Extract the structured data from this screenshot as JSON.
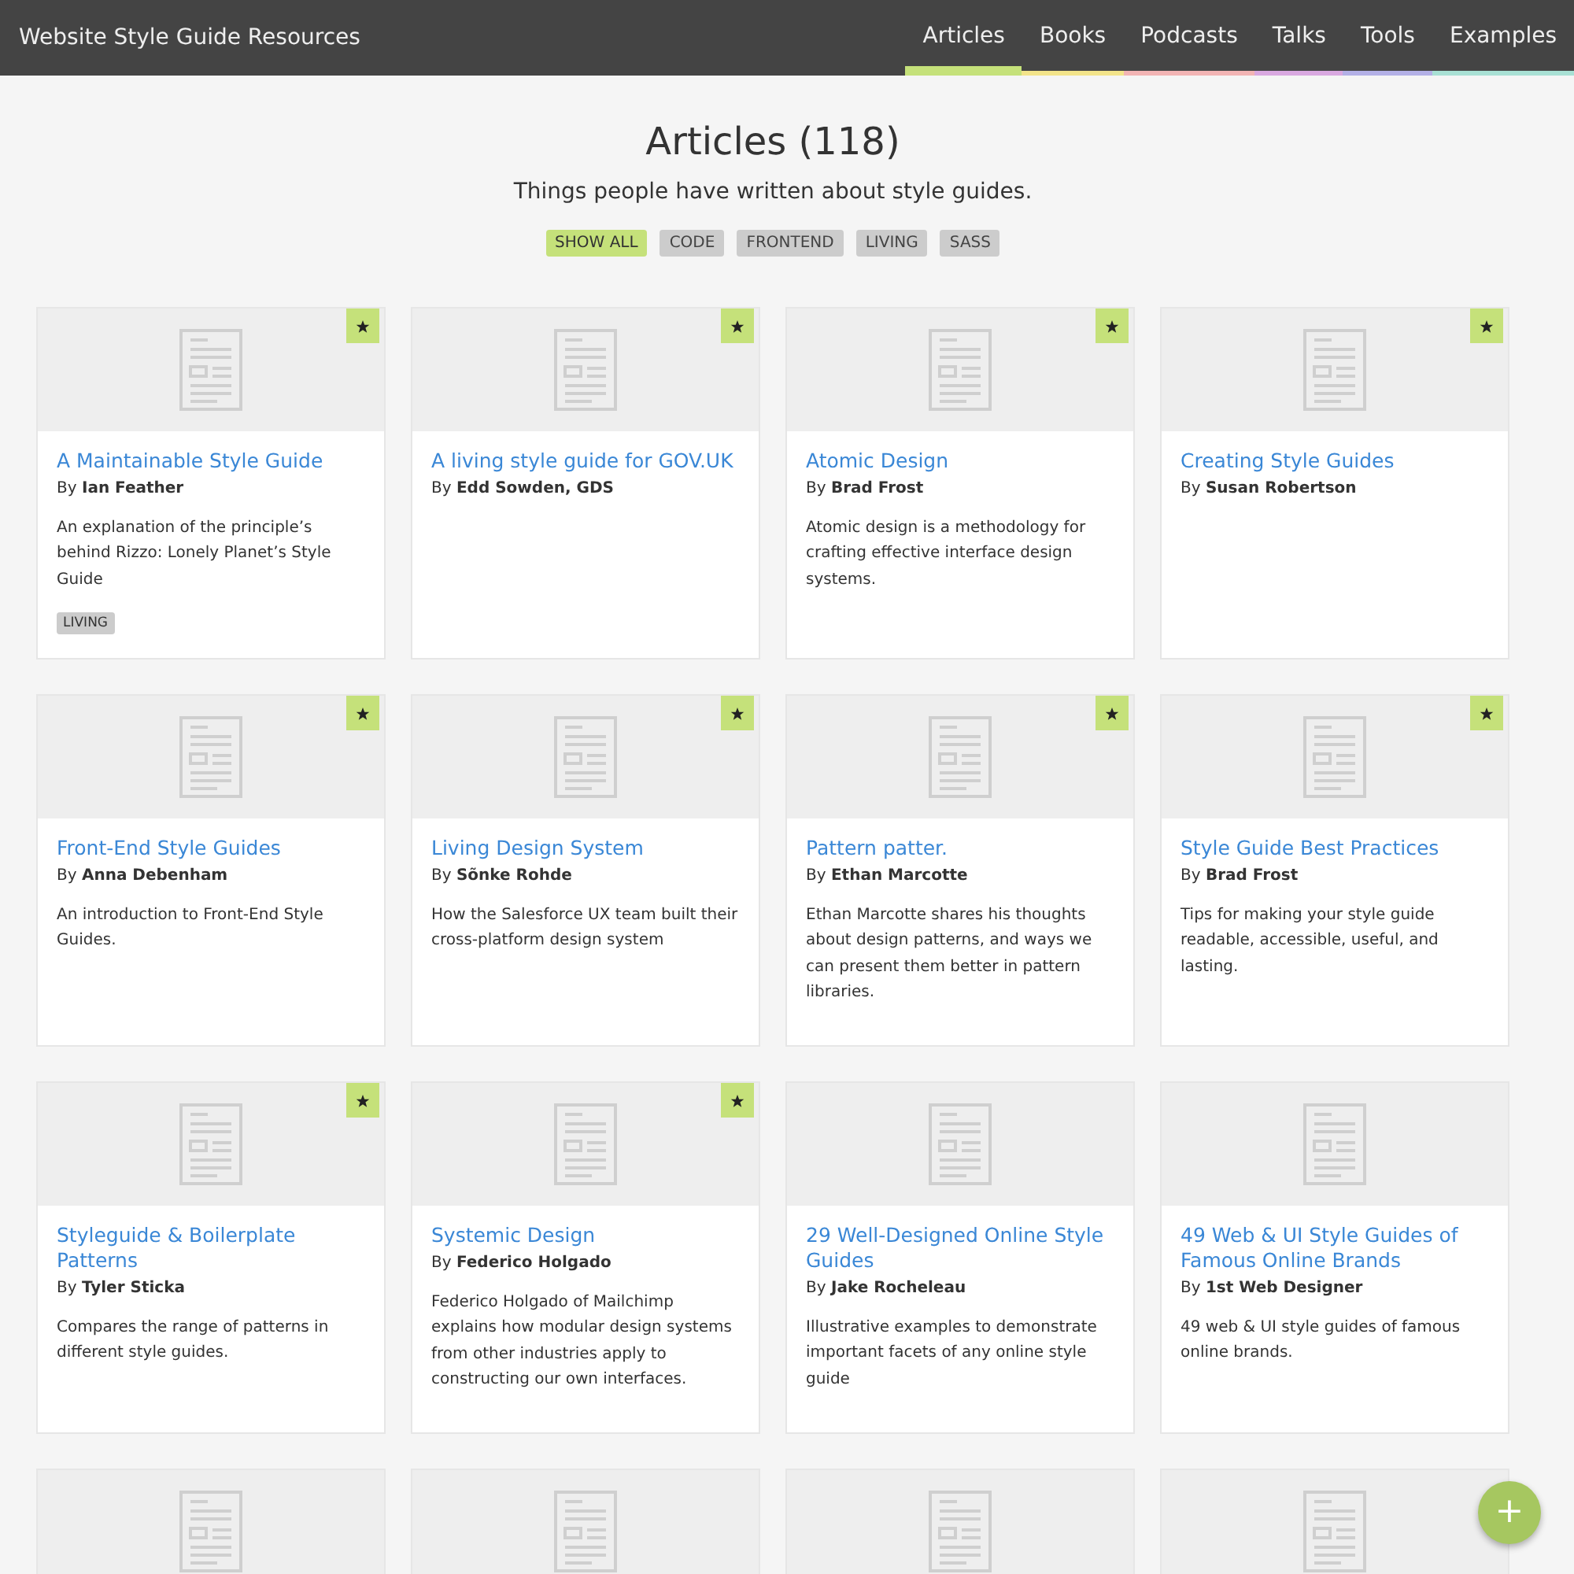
{
  "site_title": "Website Style Guide Resources",
  "nav": [
    {
      "label": "Articles",
      "selected": true,
      "color": "#c5e17a"
    },
    {
      "label": "Books",
      "selected": false,
      "color": "#f3e48a"
    },
    {
      "label": "Podcasts",
      "selected": false,
      "color": "#f2b4b4"
    },
    {
      "label": "Talks",
      "selected": false,
      "color": "#d9a8e0"
    },
    {
      "label": "Tools",
      "selected": false,
      "color": "#b3b0e6"
    },
    {
      "label": "Examples",
      "selected": false,
      "color": "#a8e0d4"
    }
  ],
  "heading": "Articles (118)",
  "subheading": "Things people have written about style guides.",
  "filters": [
    {
      "label": "SHOW ALL",
      "selected": true
    },
    {
      "label": "CODE",
      "selected": false
    },
    {
      "label": "FRONTEND",
      "selected": false
    },
    {
      "label": "LIVING",
      "selected": false
    },
    {
      "label": "SASS",
      "selected": false
    }
  ],
  "cards": [
    {
      "featured": true,
      "title": "A Maintainable Style Guide",
      "by": "By",
      "author": "Ian Feather",
      "description": "An explanation of the principle’s behind Rizzo: Lonely Planet’s Style Guide",
      "tags": [
        "LIVING"
      ]
    },
    {
      "featured": true,
      "title": "A living style guide for GOV.UK",
      "by": "By",
      "author": "Edd Sowden, GDS"
    },
    {
      "featured": true,
      "title": "Atomic Design",
      "by": "By",
      "author": "Brad Frost",
      "description": "Atomic design is a methodology for crafting effective interface design systems."
    },
    {
      "featured": true,
      "title": "Creating Style Guides",
      "by": "By",
      "author": "Susan Robertson"
    },
    {
      "featured": true,
      "title": "Front-End Style Guides",
      "by": "By",
      "author": "Anna Debenham",
      "description": "An introduction to Front-End Style Guides."
    },
    {
      "featured": true,
      "title": "Living Design System",
      "by": "By",
      "author": "Sõnke Rohde",
      "description": "How the Salesforce UX team built their cross-platform design system"
    },
    {
      "featured": true,
      "title": "Pattern patter.",
      "by": "By",
      "author": "Ethan Marcotte",
      "description": "Ethan Marcotte shares his thoughts about design patterns, and ways we can present them better in pattern libraries."
    },
    {
      "featured": true,
      "title": "Style Guide Best Practices",
      "by": "By",
      "author": "Brad Frost",
      "description": "Tips for making your style guide readable, accessible, useful, and lasting."
    },
    {
      "featured": true,
      "title": "Styleguide & Boilerplate Patterns",
      "by": "By",
      "author": "Tyler Sticka",
      "description": "Compares the range of patterns in different style guides."
    },
    {
      "featured": true,
      "title": "Systemic Design",
      "by": "By",
      "author": "Federico Holgado",
      "description": "Federico Holgado of Mailchimp explains how modular design systems from other industries apply to constructing our own interfaces."
    },
    {
      "featured": false,
      "title": "29 Well-Designed Online Style Guides",
      "by": "By",
      "author": "Jake Rocheleau",
      "description": "Illustrative examples to demonstrate important facets of any online style guide"
    },
    {
      "featured": false,
      "title": "49 Web & UI Style Guides of Famous Online Brands",
      "by": "By",
      "author": "1st Web Designer",
      "description": "49 web & UI style guides of famous online brands."
    },
    {
      "featured": false
    },
    {
      "featured": false
    },
    {
      "featured": false
    },
    {
      "featured": false
    }
  ],
  "add_button": "+"
}
